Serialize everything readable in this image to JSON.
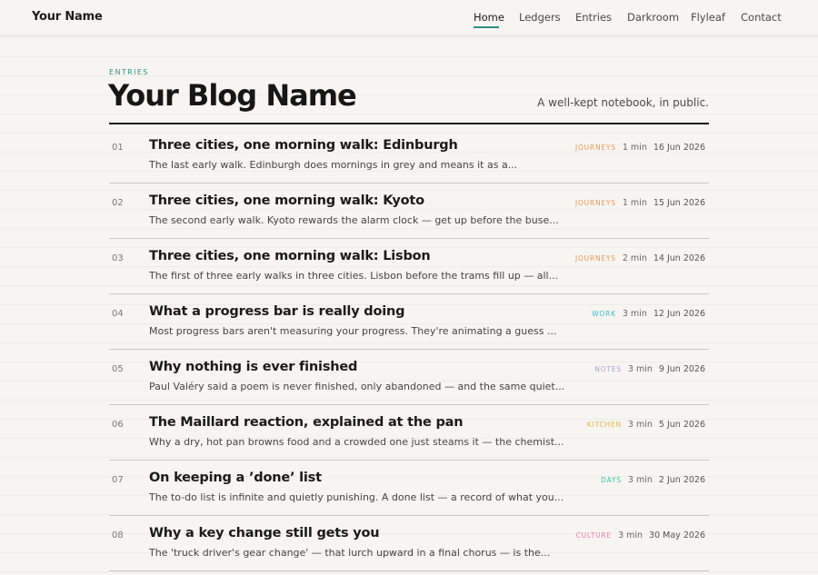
{
  "brand": {
    "name": "Your Name"
  },
  "nav": {
    "items": [
      {
        "label": "Home",
        "active": true
      },
      {
        "label": "Ledgers",
        "active": false
      },
      {
        "label": "Entries",
        "active": false
      },
      {
        "label": "Darkroom",
        "active": false
      },
      {
        "label": "Flyleaf",
        "active": false
      },
      {
        "label": "Contact",
        "active": false
      }
    ]
  },
  "header": {
    "eyebrow": "ENTRIES",
    "title": "Your Blog Name",
    "tagline": "A well-kept notebook, in public."
  },
  "colors": {
    "accent": "#2f8f86",
    "journeys": "#e8955a",
    "work": "#4ab6c8",
    "notes": "#a6a6e0",
    "kitchen": "#e6b24a",
    "days": "#3fbfa8",
    "culture": "#e87aa8"
  },
  "entries": [
    {
      "num": "01",
      "title": "Three cities, one morning walk: Edinburgh",
      "excerpt": "The last early walk. Edinburgh does mornings in grey and means it as a...",
      "tag": "JOURNEYS",
      "tag_color": "#e8955a",
      "read": "1 min",
      "date": "16 Jun 2026"
    },
    {
      "num": "02",
      "title": "Three cities, one morning walk: Kyoto",
      "excerpt": "The second early walk. Kyoto rewards the alarm clock — get up before the buse...",
      "tag": "JOURNEYS",
      "tag_color": "#e8955a",
      "read": "1 min",
      "date": "15 Jun 2026"
    },
    {
      "num": "03",
      "title": "Three cities, one morning walk: Lisbon",
      "excerpt": "The first of three early walks in three cities. Lisbon before the trams fill up — all...",
      "tag": "JOURNEYS",
      "tag_color": "#e8955a",
      "read": "2 min",
      "date": "14 Jun 2026"
    },
    {
      "num": "04",
      "title": "What a progress bar is really doing",
      "excerpt": "Most progress bars aren't measuring your progress. They're animating a guess ...",
      "tag": "WORK",
      "tag_color": "#4ab6c8",
      "read": "3 min",
      "date": "12 Jun 2026"
    },
    {
      "num": "05",
      "title": "Why nothing is ever finished",
      "excerpt": "Paul Valéry said a poem is never finished, only abandoned — and the same quiet...",
      "tag": "NOTES",
      "tag_color": "#a6a6e0",
      "read": "3 min",
      "date": "9 Jun 2026"
    },
    {
      "num": "06",
      "title": "The Maillard reaction, explained at the pan",
      "excerpt": "Why a dry, hot pan browns food and a crowded one just steams it — the chemist...",
      "tag": "KITCHEN",
      "tag_color": "#e6b24a",
      "read": "3 min",
      "date": "5 Jun 2026"
    },
    {
      "num": "07",
      "title": "On keeping a ’done’ list",
      "excerpt": "The to-do list is infinite and quietly punishing. A done list — a record of what you...",
      "tag": "DAYS",
      "tag_color": "#3fbfa8",
      "read": "3 min",
      "date": "2 Jun 2026"
    },
    {
      "num": "08",
      "title": "Why a key change still gets you",
      "excerpt": "The 'truck driver's gear change' — that lurch upward in a final chorus — is the...",
      "tag": "CULTURE",
      "tag_color": "#e87aa8",
      "read": "3 min",
      "date": "30 May 2026"
    }
  ]
}
